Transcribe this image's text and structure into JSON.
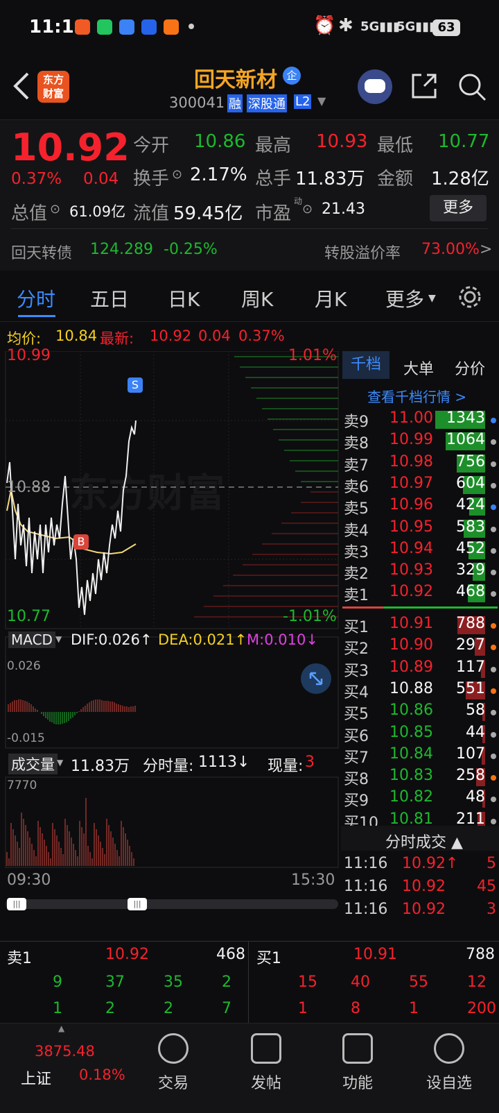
{
  "status": {
    "time": "11:16",
    "battery": "63"
  },
  "stock": {
    "name": "回天新材",
    "badge": "企",
    "code": "300041",
    "tags": [
      "融",
      "深股通",
      "L2"
    ]
  },
  "quote": {
    "price": "10.92",
    "pct": "0.37%",
    "chg": "0.04",
    "open_label": "今开",
    "open": "10.86",
    "high_label": "最高",
    "high": "10.93",
    "low_label": "最低",
    "low": "10.77",
    "turnover_label": "换手",
    "turnover": "2.17%",
    "volume_label": "总手",
    "volume": "11.83万",
    "amount_label": "金额",
    "amount": "1.28亿",
    "mcap_label": "总值",
    "mcap": "61.09亿",
    "float_label": "流值",
    "float": "59.45亿",
    "pe_label": "市盈",
    "pe_sup": "动",
    "pe": "21.43",
    "more": "更多",
    "bond_name": "回天转债",
    "bond_price": "124.289",
    "bond_pct": "-0.25%",
    "premium_label": "转股溢价率",
    "premium": "73.00%"
  },
  "tabs": [
    "分时",
    "五日",
    "日K",
    "周K",
    "月K",
    "更多"
  ],
  "avg": {
    "avg_label": "均价:",
    "avg": "10.84",
    "last_label": "最新:",
    "last": "10.92",
    "chg": "0.04",
    "pct": "0.37%"
  },
  "chart": {
    "top_price": "10.99",
    "top_pct": "1.01%",
    "mid_price": "10.88",
    "bottom_price": "10.77",
    "bottom_pct": "-1.01%",
    "watermark": "东方财富",
    "marker_s": "S",
    "marker_b": "B",
    "macd_label": "MACD",
    "dif": "DIF:0.026↑",
    "dea": "DEA:0.021↑",
    "m": "M:0.010↓",
    "macd_top": "0.026",
    "macd_bottom": "-0.015",
    "vol_label": "成交量",
    "vol_total": "11.83万",
    "vol_tick_label": "分时量:",
    "vol_tick": "1113↓",
    "vol_now_label": "现量:",
    "vol_now": "3",
    "vol_max": "7770",
    "time_start": "09:30",
    "time_end": "15:30"
  },
  "orderbook": {
    "tab1": "千档",
    "tab2": "大单",
    "tab3": "分价",
    "link": "查看千档行情 >",
    "asks": [
      {
        "label": "卖9",
        "price": "11.00",
        "vol": "1343",
        "color": "green",
        "dot": "#3b82f6"
      },
      {
        "label": "卖8",
        "price": "10.99",
        "vol": "1064",
        "color": "green",
        "dot": "#aaaaaa"
      },
      {
        "label": "卖7",
        "price": "10.98",
        "vol": "756",
        "color": "green",
        "dot": "#aaaaaa"
      },
      {
        "label": "卖6",
        "price": "10.97",
        "vol": "604",
        "color": "green",
        "dot": "#aaaaaa"
      },
      {
        "label": "卖5",
        "price": "10.96",
        "vol": "424",
        "color": "green",
        "dot": "#3b82f6"
      },
      {
        "label": "卖4",
        "price": "10.95",
        "vol": "583",
        "color": "green",
        "dot": "#aaaaaa"
      },
      {
        "label": "卖3",
        "price": "10.94",
        "vol": "452",
        "color": "green",
        "dot": "#aaaaaa"
      },
      {
        "label": "卖2",
        "price": "10.93",
        "vol": "329",
        "color": "green",
        "dot": "#aaaaaa"
      },
      {
        "label": "卖1",
        "price": "10.92",
        "vol": "468",
        "color": "green",
        "dot": "#aaaaaa"
      }
    ],
    "bids": [
      {
        "label": "买1",
        "price": "10.91",
        "vol": "788",
        "pcolor": "#f5222d",
        "dot": "#f97316"
      },
      {
        "label": "买2",
        "price": "10.90",
        "vol": "297",
        "pcolor": "#f5222d",
        "dot": "#f97316"
      },
      {
        "label": "买3",
        "price": "10.89",
        "vol": "117",
        "pcolor": "#f5222d",
        "dot": "#aaaaaa"
      },
      {
        "label": "买4",
        "price": "10.88",
        "vol": "551",
        "pcolor": "#f2f2f2",
        "dot": "#f97316"
      },
      {
        "label": "买5",
        "price": "10.86",
        "vol": "58",
        "pcolor": "#1db92f",
        "dot": "#aaaaaa"
      },
      {
        "label": "买6",
        "price": "10.85",
        "vol": "44",
        "pcolor": "#1db92f",
        "dot": "#aaaaaa"
      },
      {
        "label": "买7",
        "price": "10.84",
        "vol": "107",
        "pcolor": "#1db92f",
        "dot": "#aaaaaa"
      },
      {
        "label": "买8",
        "price": "10.83",
        "vol": "258",
        "pcolor": "#1db92f",
        "dot": "#f97316"
      },
      {
        "label": "买9",
        "price": "10.82",
        "vol": "48",
        "pcolor": "#1db92f",
        "dot": "#aaaaaa"
      },
      {
        "label": "买10",
        "price": "10.81",
        "vol": "211",
        "pcolor": "#1db92f",
        "dot": "#aaaaaa"
      }
    ],
    "trades_label": "分时成交 ▲",
    "trades": [
      {
        "time": "11:16",
        "price": "10.92↑",
        "vol": "5"
      },
      {
        "time": "11:16",
        "price": "10.92",
        "vol": "45"
      },
      {
        "time": "11:16",
        "price": "10.92",
        "vol": "3"
      }
    ]
  },
  "bottom_tables": {
    "sell": {
      "label": "卖1",
      "price": "10.92",
      "vol": "468",
      "row1": [
        "9",
        "37",
        "35",
        "2"
      ],
      "row2": [
        "1",
        "2",
        "2",
        "7"
      ]
    },
    "buy": {
      "label": "买1",
      "price": "10.91",
      "vol": "788",
      "row1": [
        "15",
        "40",
        "55",
        "12"
      ],
      "row2": [
        "1",
        "8",
        "1",
        "200"
      ]
    }
  },
  "bottom_nav": {
    "index_value": "3875.48",
    "index_name": "上证",
    "index_pct": "0.18%",
    "items": [
      "交易",
      "发帖",
      "功能",
      "设自选"
    ]
  }
}
